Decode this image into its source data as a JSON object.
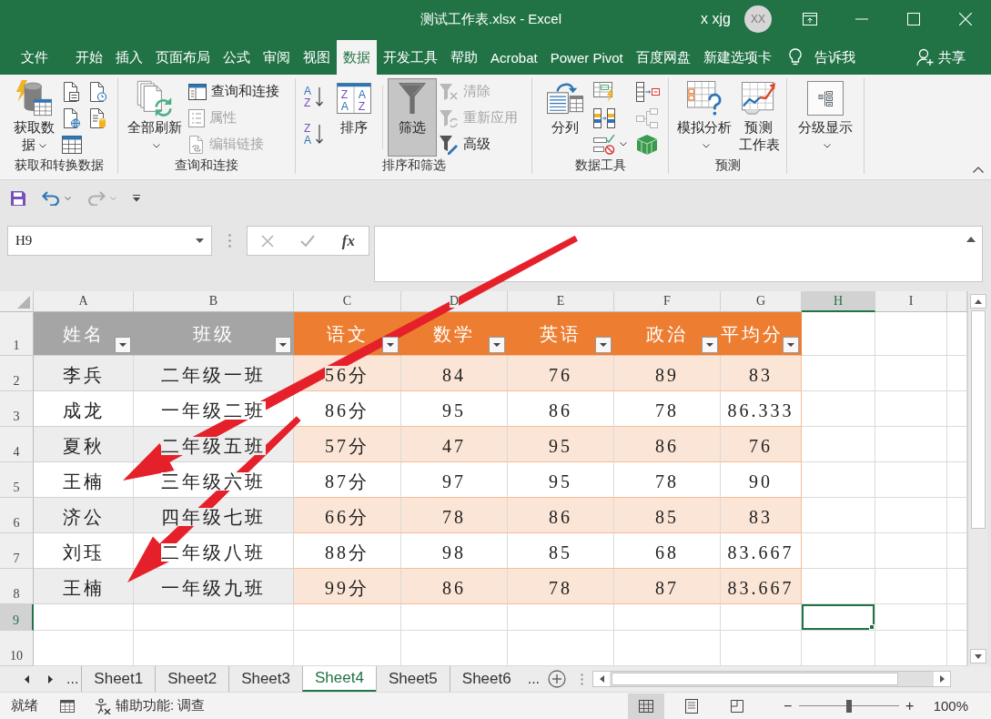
{
  "window": {
    "title": "测试工作表.xlsx - Excel",
    "user_name": "x xjg",
    "user_initials": "XX"
  },
  "ribbon_tabs": [
    {
      "label": "文件",
      "selected": false
    },
    {
      "label": "开始",
      "selected": false
    },
    {
      "label": "插入",
      "selected": false
    },
    {
      "label": "页面布局",
      "selected": false
    },
    {
      "label": "公式",
      "selected": false
    },
    {
      "label": "审阅",
      "selected": false
    },
    {
      "label": "视图",
      "selected": false
    },
    {
      "label": "数据",
      "selected": true
    },
    {
      "label": "开发工具",
      "selected": false
    },
    {
      "label": "帮助",
      "selected": false
    },
    {
      "label": "Acrobat",
      "selected": false
    },
    {
      "label": "Power Pivot",
      "selected": false
    },
    {
      "label": "百度网盘",
      "selected": false
    },
    {
      "label": "新建选项卡",
      "selected": false
    }
  ],
  "tell_me": "告诉我",
  "share": "共享",
  "ribbon_groups": [
    {
      "label": "获取和转换数据",
      "items": [
        {
          "label": "获取数据",
          "dropdown": true,
          "on": false
        },
        {
          "disabled": false
        },
        {
          "disabled": false
        },
        {
          "disabled": false
        },
        {
          "disabled": false
        },
        {
          "disabled": false
        }
      ]
    },
    {
      "label": "查询和连接",
      "items": [
        {
          "label": "全部刷新",
          "dropdown": true,
          "on": false
        },
        {
          "label": "查询和连接",
          "disabled": false
        },
        {
          "label": "属性",
          "disabled": true
        },
        {
          "label": "编辑链接",
          "disabled": true
        }
      ]
    },
    {
      "label": "排序和筛选",
      "items": [
        {
          "letters": [
            "A",
            "Z"
          ],
          "disabled": false
        },
        {
          "letters": [
            "Z",
            "A"
          ],
          "disabled": false
        },
        {
          "label": "排序",
          "letters": [
            "Z",
            "A",
            "A",
            "Z"
          ],
          "dropdown": false,
          "on": false
        },
        {
          "label": "筛选",
          "dropdown": false,
          "on": true
        },
        {
          "label": "清除",
          "disabled": true
        },
        {
          "label": "重新应用",
          "disabled": true
        },
        {
          "label": "高级",
          "disabled": false
        }
      ]
    },
    {
      "label": "数据工具",
      "items": [
        {
          "label": "分列",
          "dropdown": false,
          "on": false
        },
        {
          "disabled": false
        },
        {
          "disabled": false
        },
        {
          "disabled": false,
          "dropdown": true
        },
        {
          "disabled": false
        },
        {
          "disabled": true
        },
        {
          "disabled": false
        }
      ]
    },
    {
      "label": "预测",
      "items": [
        {
          "label": "模拟分析",
          "dropdown": true,
          "on": false
        },
        {
          "label": "预测工作表",
          "dropdown": false,
          "on": false
        }
      ]
    },
    {
      "items": [
        {
          "label": "分级显示",
          "dropdown": true,
          "on": false
        }
      ]
    }
  ],
  "quick_access": [
    {
      "kind": "save",
      "disabled": false
    },
    {
      "kind": "undo",
      "disabled": false
    },
    {
      "kind": "redo",
      "disabled": true
    },
    {
      "kind": "customize",
      "disabled": false
    }
  ],
  "formula_bar": {
    "name_box": "H9",
    "buttons": [
      {
        "kind": "cancel",
        "disabled": true
      },
      {
        "kind": "enter",
        "disabled": true
      },
      {
        "kind": "function",
        "label": "fx",
        "disabled": false
      }
    ]
  },
  "sheet": {
    "columns": [
      {
        "label": "A",
        "selected": false
      },
      {
        "label": "B",
        "selected": false
      },
      {
        "label": "C",
        "selected": false
      },
      {
        "label": "D",
        "selected": false
      },
      {
        "label": "E",
        "selected": false
      },
      {
        "label": "F",
        "selected": false
      },
      {
        "label": "G",
        "selected": false
      },
      {
        "label": "H",
        "selected": true
      },
      {
        "label": "I",
        "selected": false
      }
    ],
    "rows": [
      {
        "label": "1",
        "selected": false
      },
      {
        "label": "2",
        "selected": false
      },
      {
        "label": "3",
        "selected": false
      },
      {
        "label": "4",
        "selected": false
      },
      {
        "label": "5",
        "selected": false
      },
      {
        "label": "6",
        "selected": false
      },
      {
        "label": "7",
        "selected": false
      },
      {
        "label": "8",
        "selected": false
      },
      {
        "label": "9",
        "selected": true
      },
      {
        "label": "10",
        "selected": false
      }
    ]
  },
  "table": {
    "columns": [
      {
        "label": "姓名",
        "color": "#a5a5a5"
      },
      {
        "label": "班级",
        "color": "#a5a5a5"
      },
      {
        "label": "语文",
        "color": "#ed7d31"
      },
      {
        "label": "数学",
        "color": "#ed7d31"
      },
      {
        "label": "英语",
        "color": "#ed7d31"
      },
      {
        "label": "政治",
        "color": "#ed7d31"
      },
      {
        "label": "平均分",
        "color": "#ed7d31"
      }
    ],
    "rows": [
      [
        "李兵",
        "二年级一班",
        "56分",
        "84",
        "76",
        "89",
        "83"
      ],
      [
        "成龙",
        "一年级二班",
        "86分",
        "95",
        "86",
        "78",
        "86.333"
      ],
      [
        "夏秋",
        "二年级五班",
        "57分",
        "47",
        "95",
        "86",
        "76"
      ],
      [
        "王楠",
        "三年级六班",
        "87分",
        "97",
        "95",
        "78",
        "90"
      ],
      [
        "济公",
        "四年级七班",
        "66分",
        "78",
        "86",
        "85",
        "83"
      ],
      [
        "刘珏",
        "二年级八班",
        "88分",
        "98",
        "85",
        "68",
        "83.667"
      ],
      [
        "王楠",
        "一年级九班",
        "99分",
        "86",
        "78",
        "87",
        "83.667"
      ]
    ]
  },
  "annotations": [
    {
      "kind": "arrow"
    },
    {
      "kind": "arrow"
    }
  ],
  "sheet_tabs": {
    "more_before": "...",
    "tabs": [
      {
        "label": "Sheet1",
        "selected": false
      },
      {
        "label": "Sheet2",
        "selected": false
      },
      {
        "label": "Sheet3",
        "selected": false
      },
      {
        "label": "Sheet4",
        "selected": true
      },
      {
        "label": "Sheet5",
        "selected": false
      },
      {
        "label": "Sheet6",
        "selected": false
      }
    ],
    "more_after": "..."
  },
  "status_bar": {
    "status": "就绪",
    "accessibility": "辅助功能: 调查",
    "views": [
      {
        "kind": "normal",
        "selected": true
      },
      {
        "kind": "page_layout",
        "selected": false
      },
      {
        "kind": "page_break",
        "selected": false
      }
    ],
    "zoom": {
      "minus": "−",
      "plus": "+",
      "level": 0.5,
      "reading": "100%"
    }
  }
}
